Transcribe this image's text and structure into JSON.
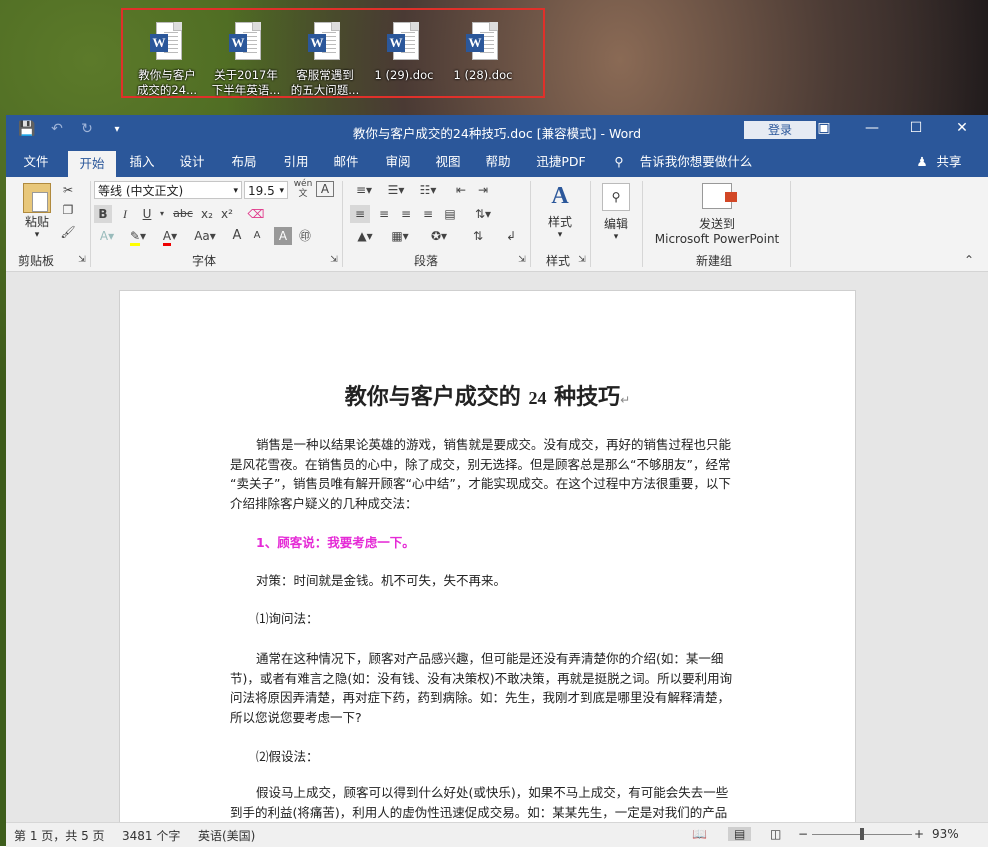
{
  "desktop": {
    "icons": [
      {
        "line1": "教你与客户",
        "line2": "成交的24..."
      },
      {
        "line1": "关于2017年",
        "line2": "下半年英语..."
      },
      {
        "line1": "客服常遇到",
        "line2": "的五大问题..."
      },
      {
        "line1": "1 (29).doc",
        "line2": ""
      },
      {
        "line1": "1 (28).doc",
        "line2": ""
      }
    ]
  },
  "window": {
    "title": "教你与客户成交的24种技巧.doc [兼容模式]  -  Word",
    "login": "登录",
    "qat": {
      "save_icon": "save-icon",
      "undo_icon": "undo-icon",
      "redo_icon": "redo-icon"
    }
  },
  "tabs": [
    "文件",
    "开始",
    "插入",
    "设计",
    "布局",
    "引用",
    "邮件",
    "审阅",
    "视图",
    "帮助",
    "迅捷PDF",
    "告诉我你想要做什么"
  ],
  "share": "共享",
  "ribbon": {
    "clipboard": {
      "paste": "粘贴",
      "label": "剪贴板"
    },
    "font": {
      "name": "等线 (中文正文)",
      "size": "19.5",
      "label": "字体",
      "bold": "B",
      "italic": "I",
      "underline": "U",
      "strike": "abc",
      "sub": "x₂",
      "sup": "x²",
      "grow": "A",
      "shrink": "A",
      "case": "Aa",
      "wen": "wén 文"
    },
    "paragraph": {
      "label": "段落"
    },
    "styles": {
      "btn": "样式",
      "label": "样式"
    },
    "editing": {
      "btn": "编辑"
    },
    "newgroup": {
      "btn1": "发送到",
      "btn2": "Microsoft PowerPoint",
      "label": "新建组"
    }
  },
  "document": {
    "heading_a": "教你与客户成交的 ",
    "heading_num": "24",
    "heading_b": " 种技巧",
    "paragraphs": [
      [
        "销售是一种以结果论英雄的游戏，销售就是要成交。没有成交，再好的销售过程也只能",
        "是风花雪夜。在销售员的心中，除了成交，别无选择。但是顾客总是那么“不够朋友”，经常",
        "“卖关子”，销售员唯有解开顾客“心中结”，才能实现成交。在这个过程中方法很重要，以下",
        "介绍排除客户疑义的几种成交法："
      ],
      [
        "1、顾客说：我要考虑一下。"
      ],
      [
        "对策：时间就是金钱。机不可失，失不再来。"
      ],
      [
        "⑴询问法："
      ],
      [
        "通常在这种情况下，顾客对产品感兴趣，但可能是还没有弄清楚你的介绍(如：某一细",
        "节)，或者有难言之隐(如：没有钱、没有决策权)不敢决策，再就是挺脱之词。所以要利用询",
        "问法将原因弄清楚，再对症下药，药到病除。如：先生，我刚才到底是哪里没有解释清楚，",
        "所以您说您要考虑一下?"
      ],
      [
        "⑵假设法："
      ],
      [
        "假设马上成交，顾客可以得到什么好处(或快乐)，如果不马上成交，有可能会失去一些",
        "到手的利益(将痛苦)，利用人的虚伪性迅速促成交易。如：某某先生，一定是对我们的产品"
      ]
    ]
  },
  "status": {
    "page": "第 1 页，共 5 页",
    "words": "3481 个字",
    "lang": "英语(美国)",
    "zoom": "93%",
    "zoom_level": 0.5
  }
}
